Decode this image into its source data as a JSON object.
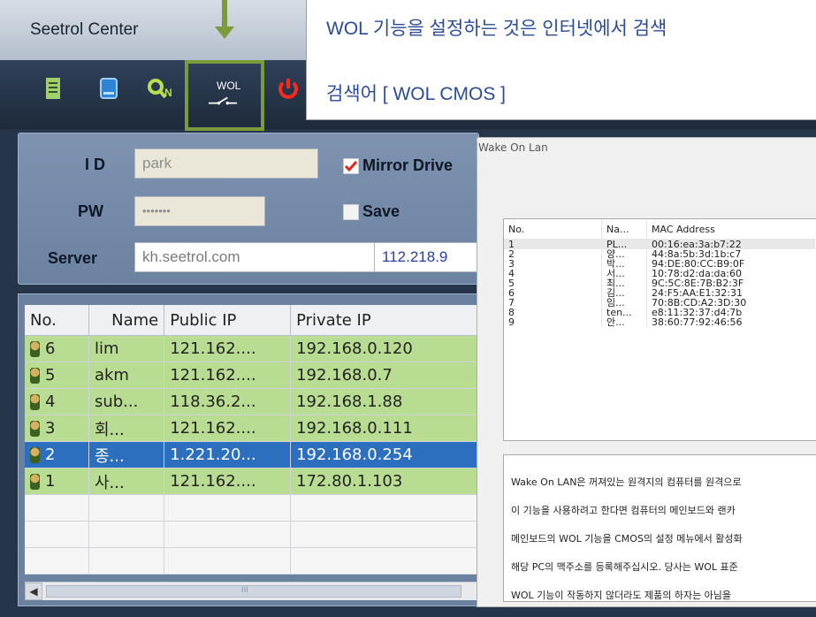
{
  "app": {
    "title": "Seetrol Center"
  },
  "toolbar": {
    "wol_label": "WOL"
  },
  "login": {
    "id_label": "I D",
    "id_value": "park",
    "pw_label": "PW",
    "pw_value": "•••••••",
    "server_label": "Server",
    "server_value": "kh.seetrol.com",
    "server_ip": "112.218.9",
    "mirror_label": "Mirror Drive",
    "save_label": "Save"
  },
  "list": {
    "headers": [
      "No.",
      "Name",
      "Public IP",
      "Private IP"
    ],
    "rows": [
      {
        "no": "6",
        "name": "lim",
        "public_ip": "121.162....",
        "private_ip": "192.168.0.120"
      },
      {
        "no": "5",
        "name": "akm",
        "public_ip": "121.162....",
        "private_ip": "192.168.0.7"
      },
      {
        "no": "4",
        "name": "sub...",
        "public_ip": "118.36.2...",
        "private_ip": "192.168.1.88"
      },
      {
        "no": "3",
        "name": "회...",
        "public_ip": "121.162....",
        "private_ip": "192.168.0.111"
      },
      {
        "no": "2",
        "name": "종...",
        "public_ip": "1.221.20...",
        "private_ip": "192.168.0.254"
      },
      {
        "no": "1",
        "name": "사...",
        "public_ip": "121.162....",
        "private_ip": "172.80.1.103"
      }
    ],
    "selected_index": 4,
    "scroll_thumb_text": "III"
  },
  "callout": {
    "line1": "WOL 기능을 설정하는 것은 인터넷에서 검색",
    "line2": "검색어 [ WOL CMOS ]"
  },
  "wol_dialog": {
    "title": "Wake On Lan",
    "headers": [
      "No.",
      "Na...",
      "MAC Address"
    ],
    "rows": [
      {
        "no": "1",
        "name": "PL...",
        "mac": "00:16:ea:3a:b7:22"
      },
      {
        "no": "2",
        "name": "양...",
        "mac": "44:8a:5b:3d:1b:c7"
      },
      {
        "no": "3",
        "name": "박...",
        "mac": "94:DE:80:CC:B9:0F"
      },
      {
        "no": "4",
        "name": "서...",
        "mac": "10:78:d2:da:da:60"
      },
      {
        "no": "5",
        "name": "최...",
        "mac": "9C:5C:8E:7B:B2:3F"
      },
      {
        "no": "6",
        "name": "김...",
        "mac": "24:F5:AA:E1:32:31"
      },
      {
        "no": "7",
        "name": "임...",
        "mac": "70:8B:CD:A2:3D:30"
      },
      {
        "no": "8",
        "name": "ten...",
        "mac": "e8:11:32:37:d4:7b"
      },
      {
        "no": "9",
        "name": "안...",
        "mac": "38:60:77:92:46:56"
      }
    ],
    "description": [
      "Wake On LAN은 꺼져있는 원격지의 컴퓨터를 원격으로",
      "이 기능을 사용하려고 한다면 컴퓨터의 메인보드와 랜카",
      "메인보드의 WOL 기능을 CMOS의 설정 메뉴에서 활성화",
      "해당 PC의 맥주소를 등록해주십시오. 당사는 WOL 표준",
      "WOL 기능이 작동하지 않더라도 제품의 하자는 아님을"
    ]
  },
  "colors": {
    "row_green": "#b9dc93",
    "row_selected": "#2d6fbf",
    "highlight": "#7b9a3c",
    "callout_text": "#2a4b9a"
  }
}
